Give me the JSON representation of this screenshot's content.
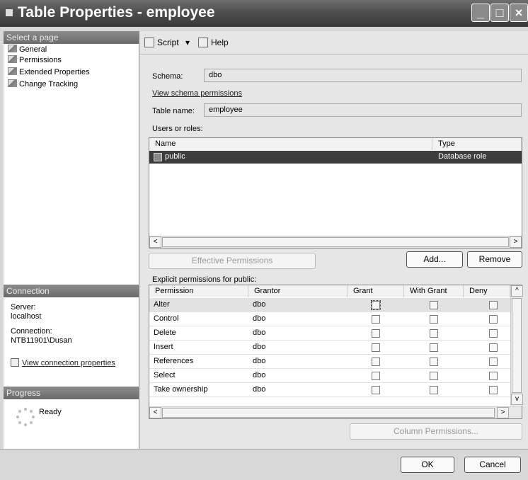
{
  "window": {
    "title": "Table Properties - employee",
    "min": "_",
    "max": "□",
    "close": "×"
  },
  "left": {
    "select_page": "Select a page",
    "pages": [
      "General",
      "Permissions",
      "Extended Properties",
      "Change Tracking"
    ],
    "connection_header": "Connection",
    "server_label": "Server:",
    "server_value": "localhost",
    "connection_label": "Connection:",
    "connection_value": "NTB11901\\Dusan",
    "view_connection": "View connection properties",
    "progress_header": "Progress",
    "progress_status": "Ready"
  },
  "toolbar": {
    "script": "Script",
    "script_arrow": "▾",
    "help": "Help"
  },
  "form": {
    "schema_label": "Schema:",
    "schema_value": "dbo",
    "view_schema_permissions": "View schema permissions",
    "table_name_label": "Table name:",
    "table_name_value": "employee",
    "users_label": "Users or roles:",
    "users_columns": [
      "Name",
      "Type"
    ],
    "users": [
      {
        "name": "public",
        "type": "Database role"
      }
    ],
    "effective_permissions": "Effective Permissions",
    "add": "Add...",
    "remove": "Remove",
    "explicit_label": "Explicit permissions for public:",
    "perm_columns": [
      "Permission",
      "Grantor",
      "Grant",
      "With Grant",
      "Deny"
    ],
    "permissions": [
      {
        "permission": "Alter",
        "grantor": "dbo"
      },
      {
        "permission": "Control",
        "grantor": "dbo"
      },
      {
        "permission": "Delete",
        "grantor": "dbo"
      },
      {
        "permission": "Insert",
        "grantor": "dbo"
      },
      {
        "permission": "References",
        "grantor": "dbo"
      },
      {
        "permission": "Select",
        "grantor": "dbo"
      },
      {
        "permission": "Take ownership",
        "grantor": "dbo"
      }
    ],
    "column_permissions": "Column Permissions..."
  },
  "footer": {
    "ok": "OK",
    "cancel": "Cancel"
  },
  "scroll": {
    "left": "<",
    "right": ">",
    "up": "^",
    "down": "v"
  }
}
